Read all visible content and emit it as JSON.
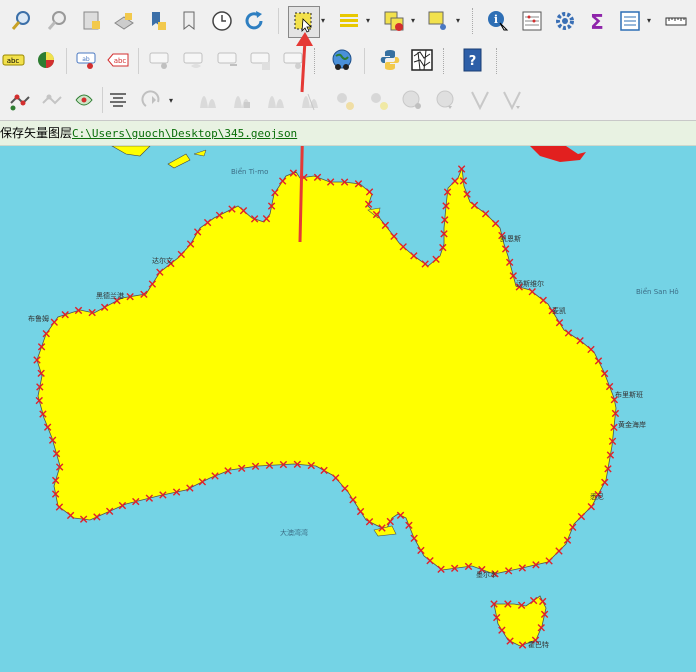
{
  "statusbar": {
    "label": "保存矢量图层",
    "path": "C:\\Users\\guoch\\Desktop\\345.geojson"
  },
  "map_labels": {
    "sea_timor": "Biển Ti-mo",
    "sea_coral": "Biển San Hô",
    "indian_ocean": "大澳湾湾"
  },
  "city_labels": {
    "darwin": "达尔文",
    "broome": "布鲁姆",
    "port_hedland": "黑德兰港",
    "exmouth": "埃克斯茅斯",
    "cairns": "凯恩斯",
    "townsville": "汤斯维尔",
    "mackay": "麦凯",
    "brisbane": "布里斯班",
    "goldcoast": "黄金海岸",
    "sydney": "悉尼",
    "melbourne": "墨尔本",
    "hobart": "霍巴特"
  },
  "icons": {
    "selected_tool": "select-features-icon",
    "annotation_arrow_color": "#e53935"
  },
  "colors": {
    "land": "#ffff00",
    "sea": "#74d3e5",
    "vertex": "#e0202a",
    "outline": "#505050"
  }
}
